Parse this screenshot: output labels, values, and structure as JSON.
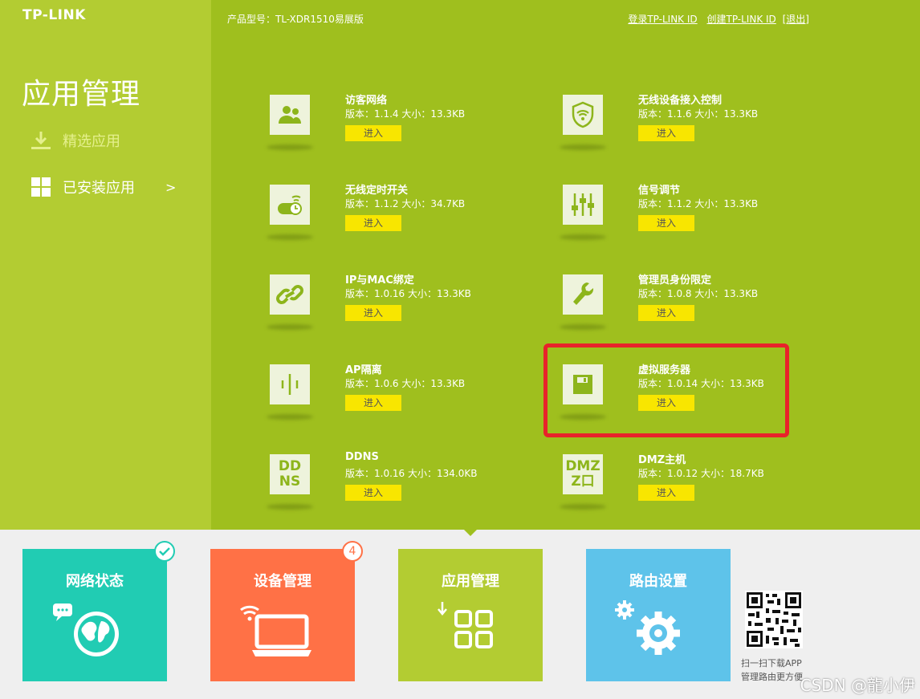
{
  "header": {
    "logo": "TP-LINK",
    "model": "产品型号：TL-XDR1510易展版",
    "links": [
      "登录TP-LINK ID",
      "创建TP-LINK ID",
      "[退出]"
    ]
  },
  "sidebar": {
    "title": "应用管理",
    "items": [
      {
        "label": "精选应用"
      },
      {
        "label": "已安装应用",
        "arrow": ">"
      }
    ]
  },
  "apps": [
    {
      "name": "访客网络",
      "meta": "版本：1.1.4  大小：13.3KB",
      "button": "进入",
      "icon": "guest-users-icon"
    },
    {
      "name": "无线设备接入控制",
      "meta": "版本：1.1.6  大小：13.3KB",
      "button": "进入",
      "icon": "wifi-shield-icon"
    },
    {
      "name": "无线定时开关",
      "meta": "版本：1.1.2  大小：34.7KB",
      "button": "进入",
      "icon": "wifi-timer-icon"
    },
    {
      "name": "信号调节",
      "meta": "版本：1.1.2  大小：13.3KB",
      "button": "进入",
      "icon": "sliders-icon"
    },
    {
      "name": "IP与MAC绑定",
      "meta": "版本：1.0.16  大小：13.3KB",
      "button": "进入",
      "icon": "link-icon"
    },
    {
      "name": "管理员身份限定",
      "meta": "版本：1.0.8  大小：13.3KB",
      "button": "进入",
      "icon": "wrench-icon"
    },
    {
      "name": "AP隔离",
      "meta": "版本：1.0.6  大小：13.3KB",
      "button": "进入",
      "icon": "ap-isolation-icon"
    },
    {
      "name": "虚拟服务器",
      "meta": "版本：1.0.14  大小：13.3KB",
      "button": "进入",
      "icon": "floppy-icon"
    },
    {
      "name": "DDNS",
      "meta": "版本：1.0.16  大小：134.0KB",
      "button": "进入",
      "icon": "ddns-icon",
      "icon_text": [
        "DD",
        "NS"
      ]
    },
    {
      "name": "DMZ主机",
      "meta": "版本：1.0.12  大小：18.7KB",
      "button": "进入",
      "icon": "dmz-icon",
      "icon_text": [
        "DMZ",
        "Z口"
      ]
    }
  ],
  "bottom_nav": [
    {
      "label": "网络状态",
      "color": "#21ccb3",
      "badge_icon": "check-icon"
    },
    {
      "label": "设备管理",
      "color": "#ff7146",
      "badge": "4"
    },
    {
      "label": "应用管理",
      "color": "#b3cc32"
    },
    {
      "label": "路由设置",
      "color": "#5ec3ea"
    }
  ],
  "qr": {
    "lines": [
      "扫一扫下载APP",
      "管理路由更方便"
    ]
  },
  "watermark": "CSDN @龍小伊",
  "colors": {
    "highlight": "#e8232a",
    "button": "#f8e600",
    "main_bg": "#9fbf1e",
    "side_bg": "#b3cc32"
  }
}
